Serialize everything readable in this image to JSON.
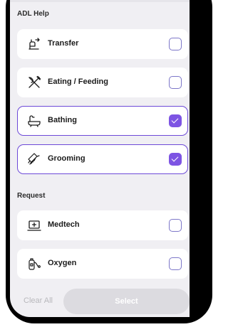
{
  "sections": {
    "adl_help": "ADL Help",
    "request": "Request"
  },
  "adl_items": [
    {
      "label": "Transfer",
      "icon": "transfer-icon",
      "checked": false
    },
    {
      "label": "Eating / Feeding",
      "icon": "utensils-icon",
      "checked": false
    },
    {
      "label": "Bathing",
      "icon": "bathtub-icon",
      "checked": true
    },
    {
      "label": "Grooming",
      "icon": "comb-icon",
      "checked": true
    }
  ],
  "request_items": [
    {
      "label": "Medtech",
      "icon": "medical-kit-icon",
      "checked": false
    },
    {
      "label": "Oxygen",
      "icon": "oxygen-tank-icon",
      "checked": false
    }
  ],
  "footer": {
    "clear_label": "Clear All",
    "select_label": "Select"
  },
  "colors": {
    "accent": "#7d54e3",
    "selected_border": "#6d49d8",
    "background": "#f0eff3",
    "disabled_button": "#dcdbe0"
  }
}
